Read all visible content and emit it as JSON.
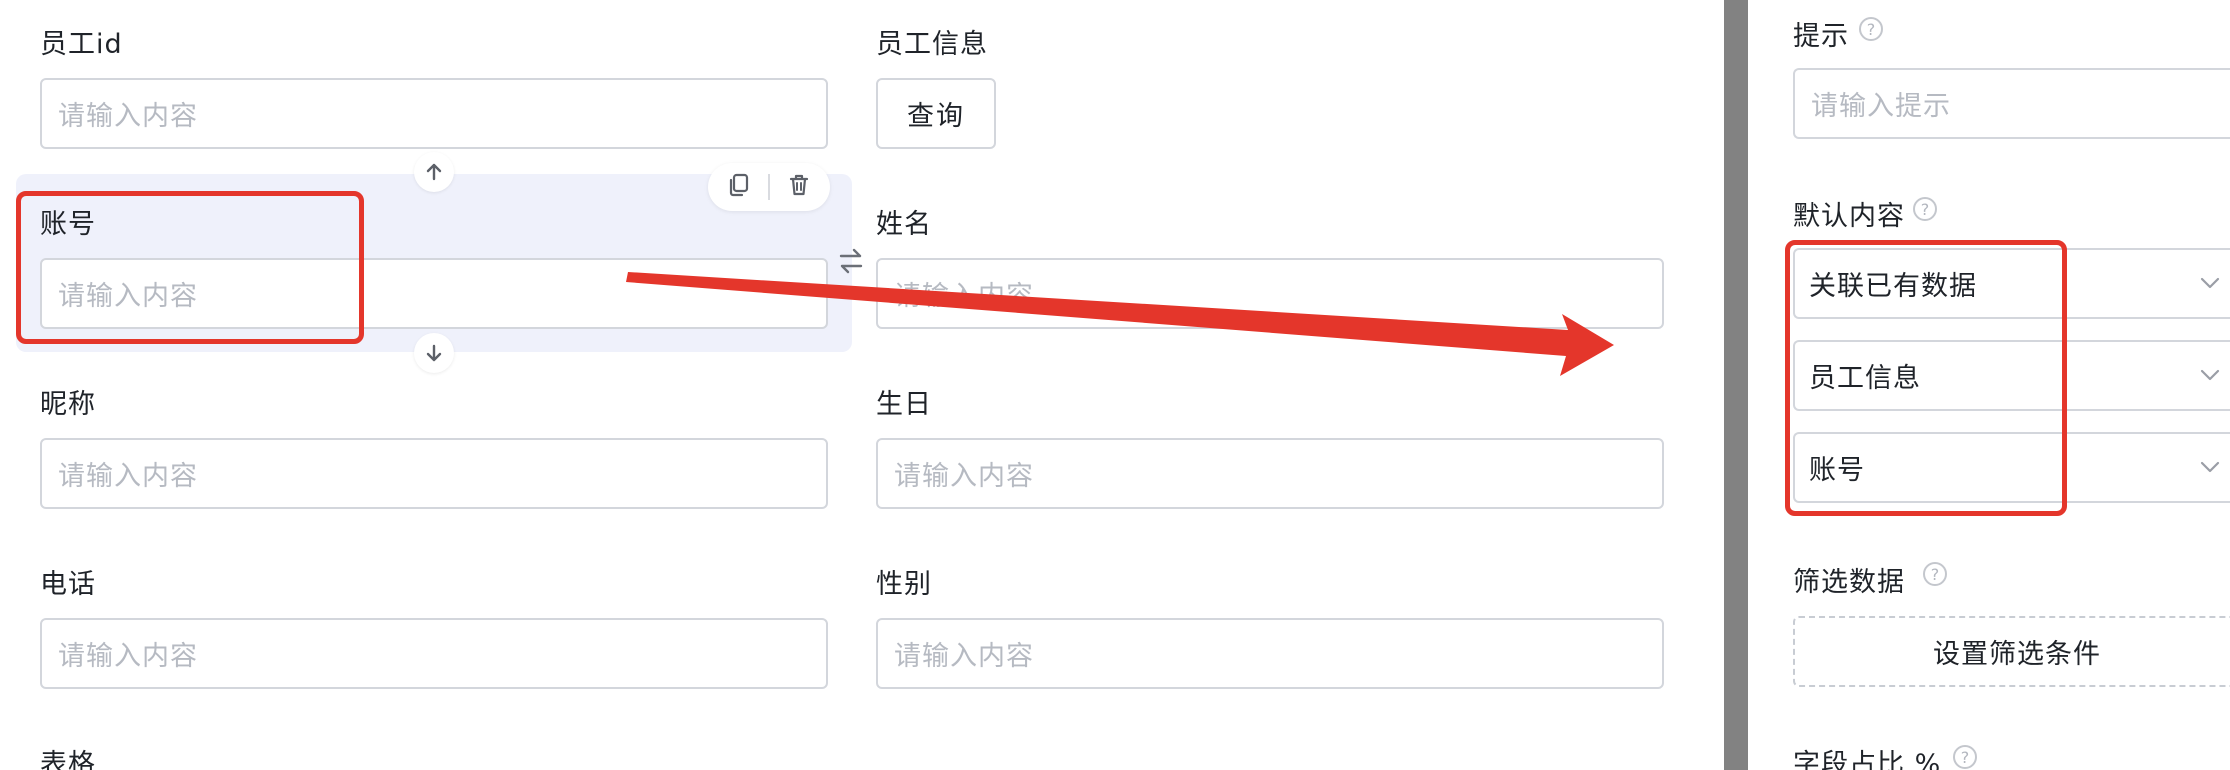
{
  "form": {
    "employee_id": {
      "label": "员工id",
      "placeholder": "请输入内容"
    },
    "employee_info": {
      "label": "员工信息",
      "button": "查询"
    },
    "account": {
      "label": "账号",
      "placeholder": "请输入内容"
    },
    "name": {
      "label": "姓名",
      "placeholder": "请输入内容"
    },
    "nickname": {
      "label": "昵称",
      "placeholder": "请输入内容"
    },
    "birthday": {
      "label": "生日",
      "placeholder": "请输入内容"
    },
    "phone": {
      "label": "电话",
      "placeholder": "请输入内容"
    },
    "gender": {
      "label": "性别",
      "placeholder": "请输入内容"
    },
    "table": {
      "label": "表格"
    }
  },
  "panel": {
    "hint": {
      "label": "提示",
      "placeholder": "请输入提示"
    },
    "default_content": {
      "label": "默认内容",
      "selects": [
        "关联已有数据",
        "员工信息",
        "账号"
      ]
    },
    "filter_data": {
      "label": "筛选数据",
      "button": "设置筛选条件"
    },
    "field_ratio": {
      "label": "字段占比 %"
    },
    "help_glyph": "?"
  },
  "icons": {
    "move_up": "arrow-up-icon",
    "move_down": "arrow-down-icon",
    "copy": "copy-icon",
    "delete": "trash-icon",
    "swap": "swap-icon",
    "chevron": "chevron-down-icon"
  },
  "colors": {
    "highlight": "#e4362b",
    "selected_bg": "#eff1fb",
    "border": "#d3d6dc",
    "placeholder": "#b6bac2"
  }
}
